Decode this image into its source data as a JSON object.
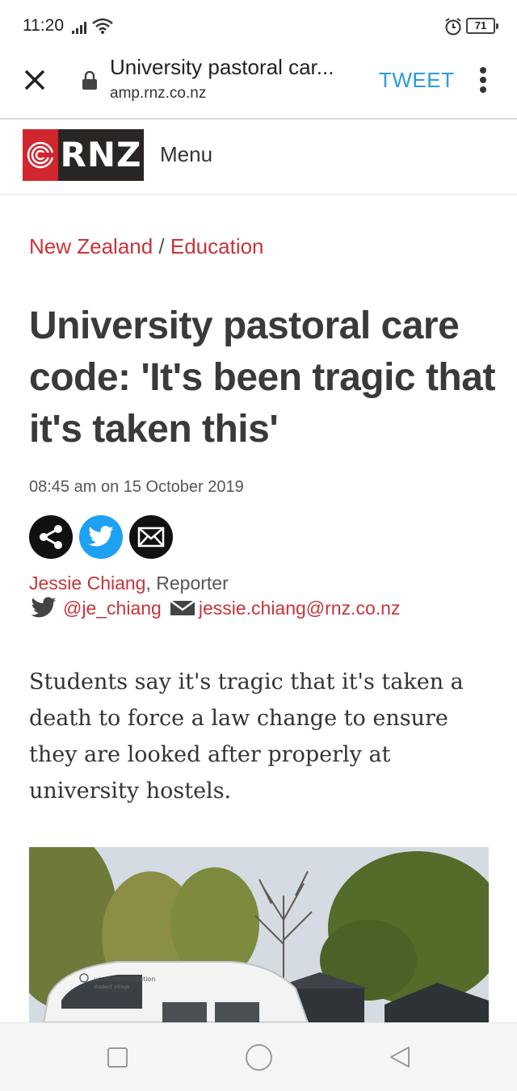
{
  "status_bar": {
    "time": "11:20",
    "battery": "71"
  },
  "browser": {
    "page_title": "University pastoral car...",
    "url": "amp.rnz.co.nz",
    "tweet_label": "TWEET"
  },
  "site_header": {
    "logo_text": "RNZ",
    "menu_label": "Menu"
  },
  "article": {
    "breadcrumb": {
      "section": "New Zealand",
      "separator": " / ",
      "subsection": "Education"
    },
    "headline": "University pastoral care code: 'It's been tragic that it's taken this'",
    "dateline": "08:45 am on 15 October 2019",
    "author": "Jessie Chiang",
    "author_role": ", Reporter",
    "twitter_handle": "@je_chiang",
    "email": "jessie.chiang@rnz.co.nz",
    "intro": "Students say it's tragic that it's taken a death to force a law change to ensure they are looked after properly at university hostels."
  },
  "colors": {
    "brand_red": "#d2262f",
    "link_red": "#c9333a",
    "tweet_blue": "#2a9cde",
    "twitter_blue": "#1da1f2"
  }
}
